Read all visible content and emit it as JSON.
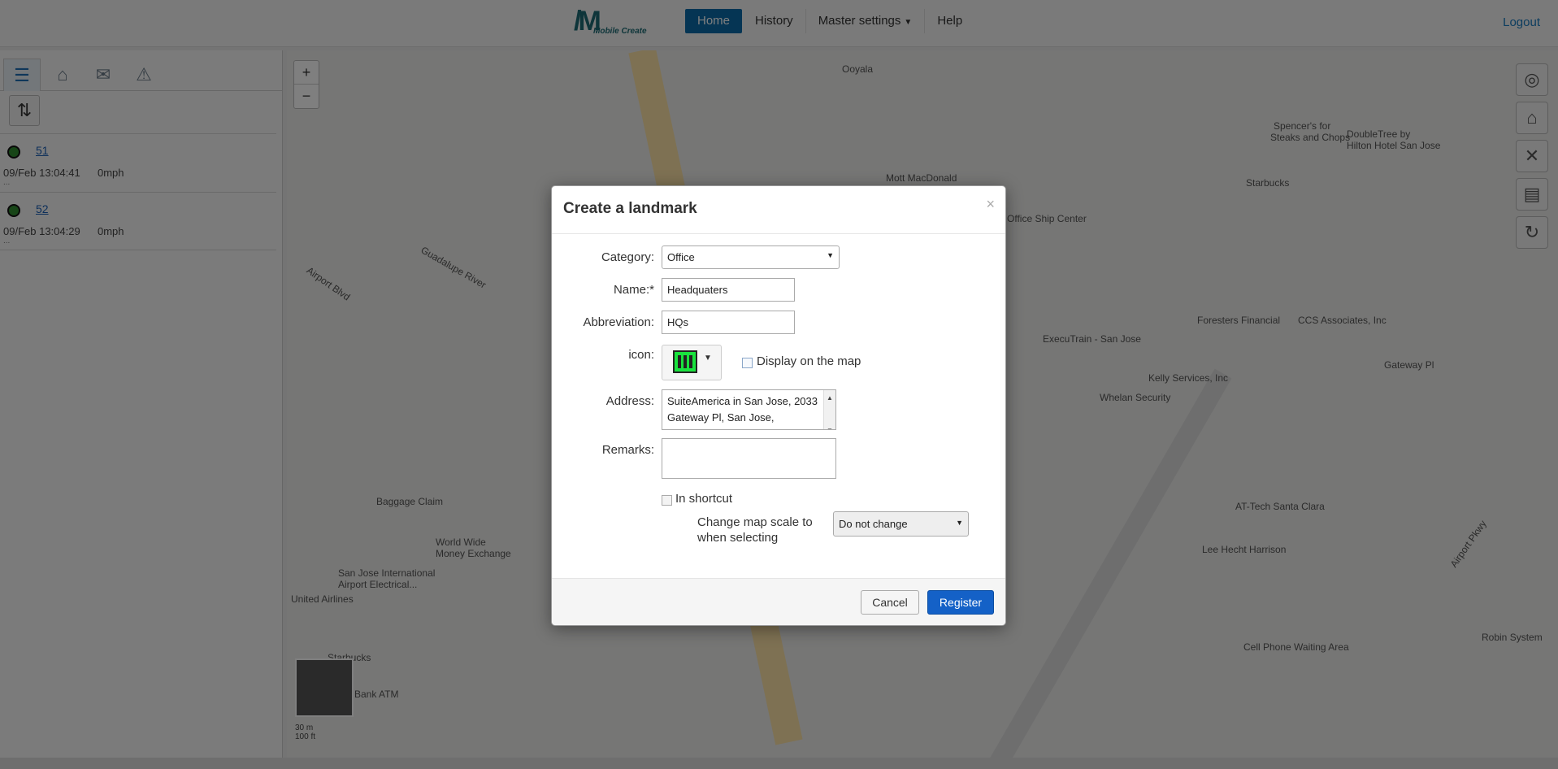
{
  "header": {
    "logo_text": "Mobile Create",
    "nav": [
      {
        "label": "Home",
        "active": true
      },
      {
        "label": "History"
      },
      {
        "label": "Master settings",
        "dropdown": true
      },
      {
        "label": "Help"
      }
    ],
    "logout": "Logout"
  },
  "sidebar": {
    "tabs": [
      "list-icon",
      "landmark-icon",
      "mail-icon",
      "alarm-icon"
    ],
    "vehicles": [
      {
        "id": "51",
        "time": "09/Feb 13:04:41",
        "speed": "0mph",
        "dots": "..."
      },
      {
        "id": "52",
        "time": "09/Feb 13:04:29",
        "speed": "0mph",
        "dots": "..."
      }
    ]
  },
  "map": {
    "zoom_in": "+",
    "zoom_out": "−",
    "labels": [
      "Ooyala",
      "Mott MacDonald",
      "Office Ship Center",
      "DoubleTree by",
      "Hilton Hotel San Jose",
      "Spencer's for",
      "Steaks and Chops",
      "Starbucks",
      "Gateway Pl",
      "Foresters Financial",
      "ExecuTrain - San Jose",
      "CCS Associates, Inc",
      "Kelly Services, Inc",
      "Whelan Security",
      "AT-Tech Santa Clara",
      "Lee Hecht Harrison",
      "Cell Phone Waiting Area",
      "Robin System",
      "Baggage Claim",
      "World Wide",
      "Money Exchange",
      "San Jose International",
      "Airport Electrical...",
      "United Airlines",
      "Starbucks",
      "Bank ATM",
      "Airport Blvd",
      "Airport Pkwy",
      "Guadalupe River"
    ],
    "scale_m": "30 m",
    "scale_ft": "100 ft"
  },
  "modal": {
    "title": "Create a landmark",
    "close": "×",
    "category_label": "Category:",
    "category_value": "Office",
    "name_label": "Name:*",
    "name_value": "Headquaters",
    "abbr_label": "Abbreviation:",
    "abbr_value": "HQs",
    "icon_label": "icon:",
    "icon_name": "office-building-icon",
    "display_on_map_label": "Display on the map",
    "address_label": "Address:",
    "address_value": "SuiteAmerica in San Jose, 2033 Gateway Pl, San Jose,",
    "remarks_label": "Remarks:",
    "remarks_value": "",
    "in_shortcut_label": "In shortcut",
    "scale_label_line1": "Change map scale to",
    "scale_label_line2": "when selecting",
    "scale_value": "Do not change",
    "cancel": "Cancel",
    "register": "Register"
  }
}
